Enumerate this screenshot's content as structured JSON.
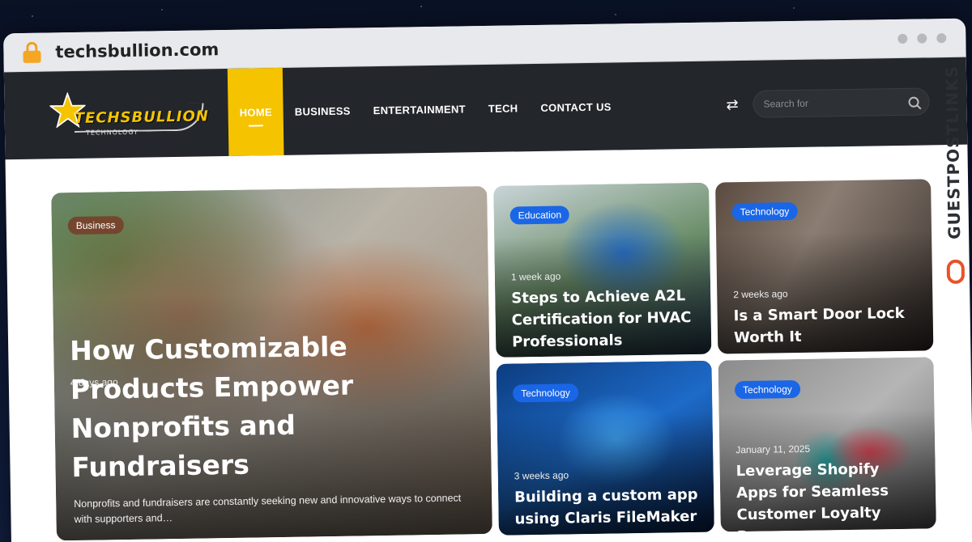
{
  "browser": {
    "url": "techsbullion.com"
  },
  "logo": {
    "name": "TECHSBULLION",
    "tagline": "TECHNOLOGY"
  },
  "nav": {
    "items": [
      "HOME",
      "BUSINESS",
      "ENTERTAINMENT",
      "TECH",
      "CONTACT US"
    ]
  },
  "search": {
    "placeholder": "Search for"
  },
  "side_brand": {
    "text": "GUESTPOSTLINKS"
  },
  "featured": {
    "category": "Business",
    "date": "4 days ago",
    "title": "How Customizable Products Empower Nonprofits and Fundraisers",
    "excerpt": "Nonprofits and fundraisers are constantly seeking new and innovative ways to connect with supporters and…"
  },
  "posts": [
    {
      "category": "Education",
      "date": "1 week ago",
      "title": "Steps to Achieve A2L Certification for HVAC Professionals"
    },
    {
      "category": "Technology",
      "date": "2 weeks ago",
      "title": "Is a Smart Door Lock Worth It"
    },
    {
      "category": "Technology",
      "date": "3 weeks ago",
      "title": "Building a custom app using Claris FileMaker"
    },
    {
      "category": "Technology",
      "date": "January 11, 2025",
      "title": "Leverage Shopify Apps for Seamless Customer Loyalty Programs"
    }
  ],
  "colors": {
    "accent": "#f5c300",
    "header_bg": "#23262b",
    "badge_blue": "#1a66e6"
  }
}
